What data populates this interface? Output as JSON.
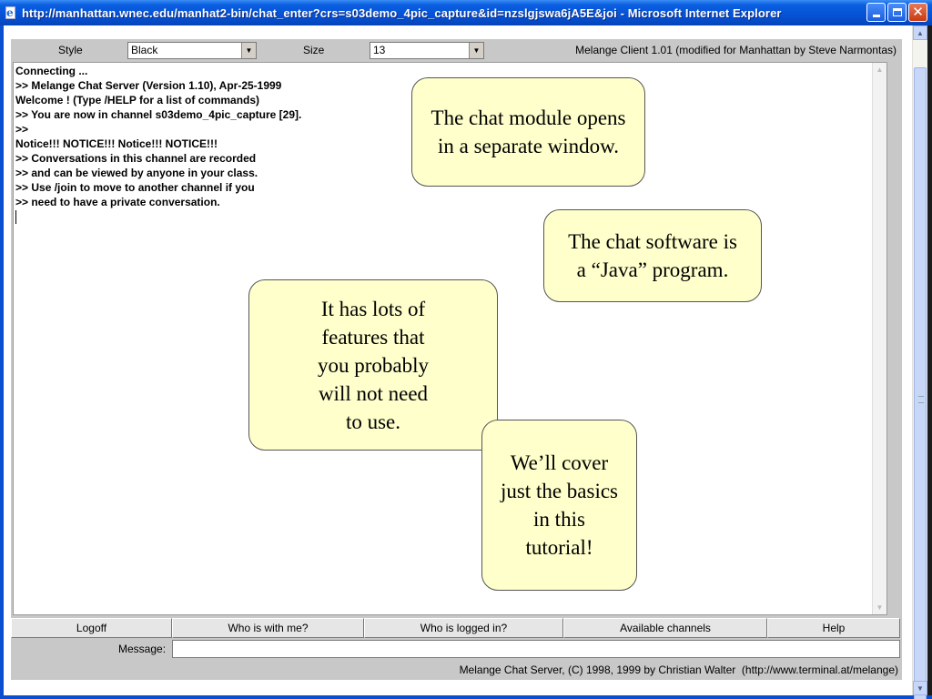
{
  "window": {
    "title": "http://manhattan.wnec.edu/manhat2-bin/chat_enter?crs=s03demo_4pic_capture&id=nzslgjswa6jA5E&joi - Microsoft Internet Explorer"
  },
  "toolbar": {
    "style_label": "Style",
    "style_value": "Black",
    "size_label": "Size",
    "size_value": "13",
    "client_version": "Melange Client 1.01 (modified for Manhattan by Steve Narmontas)"
  },
  "chat_log": [
    "Connecting ...",
    ">> Melange Chat Server (Version 1.10), Apr-25-1999",
    "Welcome ! (Type /HELP for a list of commands)",
    ">> You are now in channel s03demo_4pic_capture [29].",
    ">>",
    "Notice!!! NOTICE!!! Notice!!! NOTICE!!!",
    ">> Conversations in this channel are recorded",
    ">> and can be viewed by anyone in your class.",
    ">> Use /join to move to another channel if you",
    ">> need to have a private conversation."
  ],
  "buttons": {
    "logoff": "Logoff",
    "who_with_me": "Who is with me?",
    "who_logged_in": "Who is logged in?",
    "available_channels": "Available channels",
    "help": "Help"
  },
  "message": {
    "label": "Message:",
    "value": ""
  },
  "server_credit": "Melange Chat Server, (C) 1998, 1999 by Christian Walter  (http://www.terminal.at/melange)",
  "callouts": {
    "separate_window": [
      "The chat module opens",
      "in a separate window."
    ],
    "java_program": [
      "The chat software is",
      "a “Java” program."
    ],
    "features": [
      "It has lots of",
      "features that",
      "you probably",
      "will not need",
      "to use."
    ],
    "basics": [
      "We’ll cover",
      "just the basics",
      "in this",
      "tutorial!"
    ]
  },
  "colors": {
    "titlebar": "#0552d6",
    "applet_bg": "#c8c8c8",
    "callout_bg": "#ffffcc"
  }
}
